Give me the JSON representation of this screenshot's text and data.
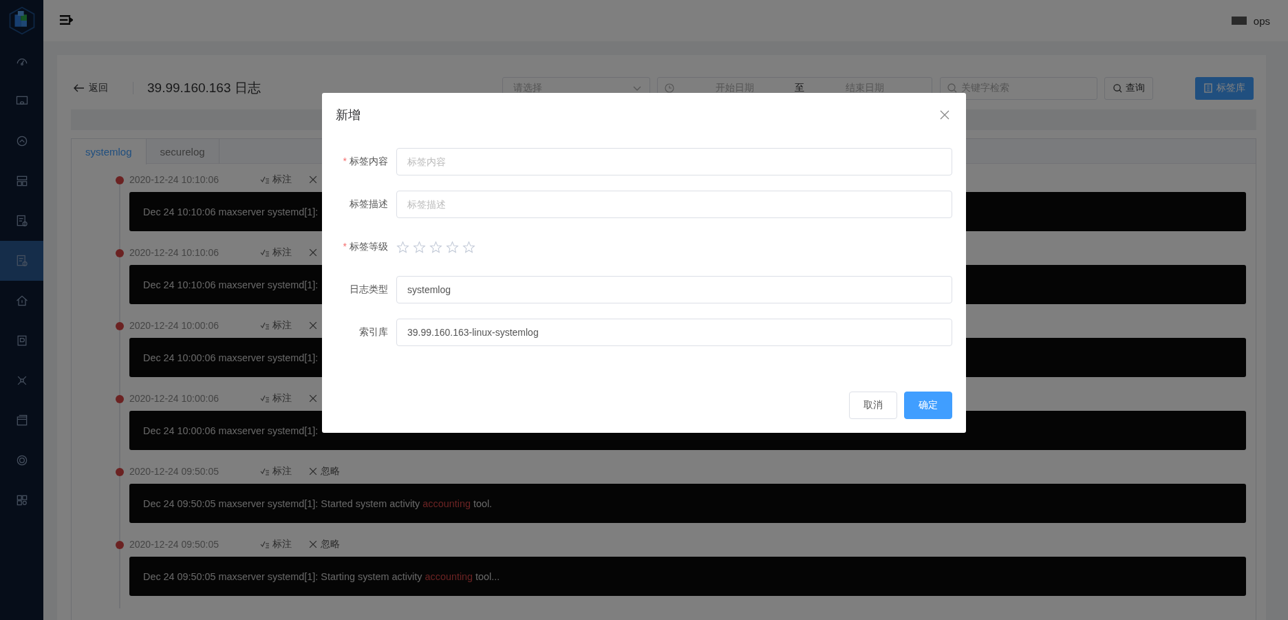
{
  "sidebar": {
    "items": [
      {
        "selected": false
      },
      {
        "selected": false
      },
      {
        "selected": false
      },
      {
        "selected": false
      },
      {
        "selected": false
      },
      {
        "selected": true
      },
      {
        "selected": false
      },
      {
        "selected": false
      },
      {
        "selected": false
      },
      {
        "selected": false
      },
      {
        "selected": false
      },
      {
        "selected": false
      }
    ]
  },
  "header": {
    "user": "ops"
  },
  "page": {
    "back": "返回",
    "title": "39.99.160.163 日志",
    "filters": {
      "select_placeholder": "请选择",
      "start_placeholder": "开始日期",
      "range_separator": "至",
      "end_placeholder": "结束日期",
      "search_placeholder": "关键字检索",
      "query_button": "查询",
      "library_button": "标签库"
    }
  },
  "tabs": [
    {
      "label": "systemlog",
      "selected": true
    },
    {
      "label": "securelog",
      "selected": false
    }
  ],
  "entries": [
    {
      "time": "2020-12-24 10:10:06",
      "mark": "标注",
      "segments": [
        {
          "text": "Dec 24 10:10:06 maxserver systemd[1]:",
          "highlight": false
        }
      ]
    },
    {
      "time": "2020-12-24 10:10:06",
      "mark": "标注",
      "segments": [
        {
          "text": "Dec 24 10:10:06 maxserver systemd[1]:",
          "highlight": false
        }
      ]
    },
    {
      "time": "2020-12-24 10:00:06",
      "mark": "标注",
      "segments": [
        {
          "text": "Dec 24 10:00:06 maxserver systemd[1]:",
          "highlight": false
        }
      ]
    },
    {
      "time": "2020-12-24 10:00:06",
      "mark": "标注",
      "segments": [
        {
          "text": "Dec 24 10:00:06 maxserver systemd[1]:",
          "highlight": false
        }
      ]
    },
    {
      "time": "2020-12-24 09:50:05",
      "mark": "标注",
      "ignore": "忽略",
      "segments": [
        {
          "text": "Dec 24 09:50:05 maxserver systemd[1]: Started system activity ",
          "highlight": false
        },
        {
          "text": "accounting",
          "highlight": true
        },
        {
          "text": " tool.",
          "highlight": false
        }
      ]
    },
    {
      "time": "2020-12-24 09:50:05",
      "mark": "标注",
      "ignore": "忽略",
      "segments": [
        {
          "text": "Dec 24 09:50:05 maxserver systemd[1]: Starting system activity ",
          "highlight": false
        },
        {
          "text": "accounting",
          "highlight": true
        },
        {
          "text": " tool...",
          "highlight": false
        }
      ]
    }
  ],
  "dialog": {
    "title": "新增",
    "fields": [
      {
        "kind": "input",
        "label": "标签内容",
        "required_mark": "*",
        "placeholder": "标签内容"
      },
      {
        "kind": "input",
        "label": "标签描述",
        "placeholder": "标签描述"
      },
      {
        "kind": "rating",
        "label": "标签等级",
        "required_mark": "*",
        "stars": 0
      },
      {
        "kind": "input",
        "label": "日志类型",
        "value": "systemlog"
      },
      {
        "kind": "input",
        "label": "索引库",
        "value": "39.99.160.163-linux-systemlog"
      }
    ],
    "buttons": [
      {
        "label": "取消",
        "kind": "default"
      },
      {
        "label": "确定",
        "kind": "primary"
      }
    ]
  }
}
